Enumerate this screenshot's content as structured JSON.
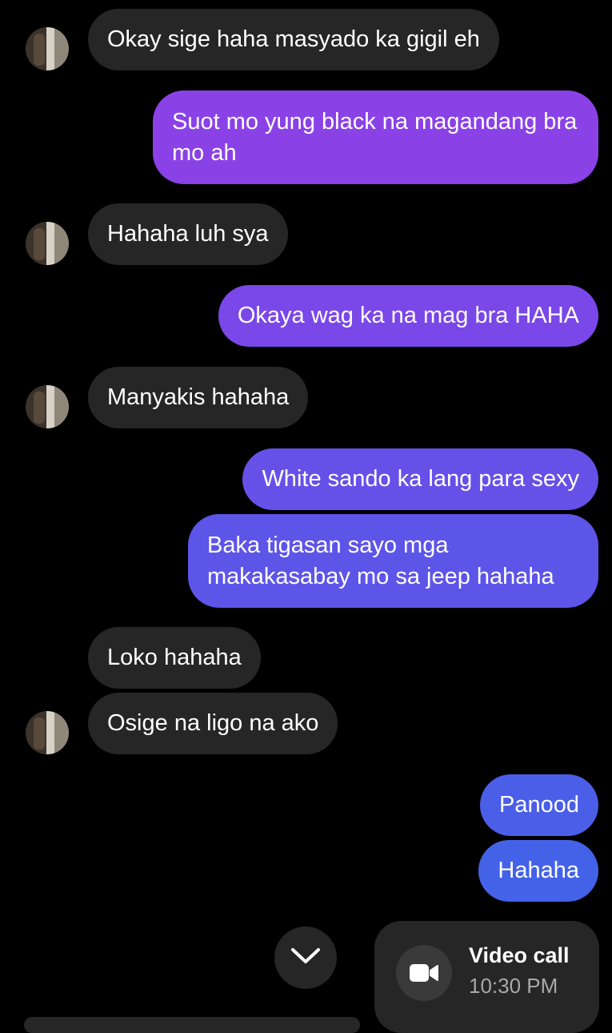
{
  "contact": {
    "avatar_icon": "contact-avatar"
  },
  "messages": [
    {
      "id": "m1",
      "direction": "incoming",
      "text": "Okay sige haha masyado ka gigil eh"
    },
    {
      "id": "m2",
      "direction": "outgoing",
      "text": "Suot mo yung black na magandang bra mo ah"
    },
    {
      "id": "m3",
      "direction": "incoming",
      "text": "Hahaha luh sya"
    },
    {
      "id": "m4",
      "direction": "outgoing",
      "text": "Okaya wag ka na mag bra HAHA"
    },
    {
      "id": "m5",
      "direction": "incoming",
      "text": "Manyakis hahaha"
    },
    {
      "id": "m6",
      "direction": "outgoing",
      "text": "White sando ka lang para sexy"
    },
    {
      "id": "m7",
      "direction": "outgoing",
      "text": "Baka tigasan sayo mga makakasabay mo sa jeep hahaha"
    },
    {
      "id": "m8",
      "direction": "incoming",
      "text": "Loko hahaha"
    },
    {
      "id": "m9",
      "direction": "incoming",
      "text": "Osige na ligo na ako"
    },
    {
      "id": "m10",
      "direction": "outgoing",
      "text": "Panood"
    },
    {
      "id": "m11",
      "direction": "outgoing",
      "text": "Hahaha"
    }
  ],
  "call_card": {
    "title": "Video call",
    "time": "10:30 PM",
    "icon": "video-camera-icon"
  },
  "controls": {
    "scroll_down_icon": "chevron-down-icon"
  },
  "colors": {
    "background": "#000000",
    "incoming_bubble": "#262626",
    "outgoing_gradient_top": "#8a3ee6",
    "outgoing_gradient_bottom": "#3f5fe6"
  }
}
